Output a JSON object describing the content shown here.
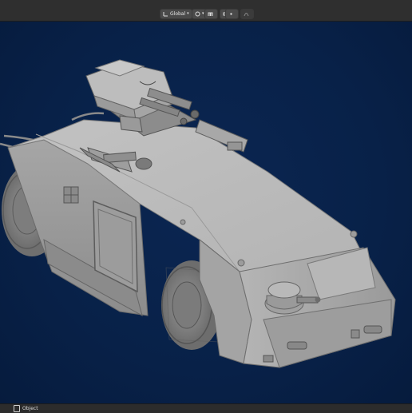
{
  "header": {
    "transform_orientation": "Global",
    "icons": [
      "orientation-icon",
      "pivot-icon",
      "snap-icon",
      "proportional-edit-icon",
      "falloff-icon"
    ]
  },
  "viewport": {
    "background": "#082148",
    "object": "armored-personnel-carrier-model"
  },
  "footer": {
    "mode_label": "Object"
  },
  "colors": {
    "model_light": "#c9c9c9",
    "model_mid": "#a9a9a9",
    "model_dark": "#7d7d7d"
  }
}
